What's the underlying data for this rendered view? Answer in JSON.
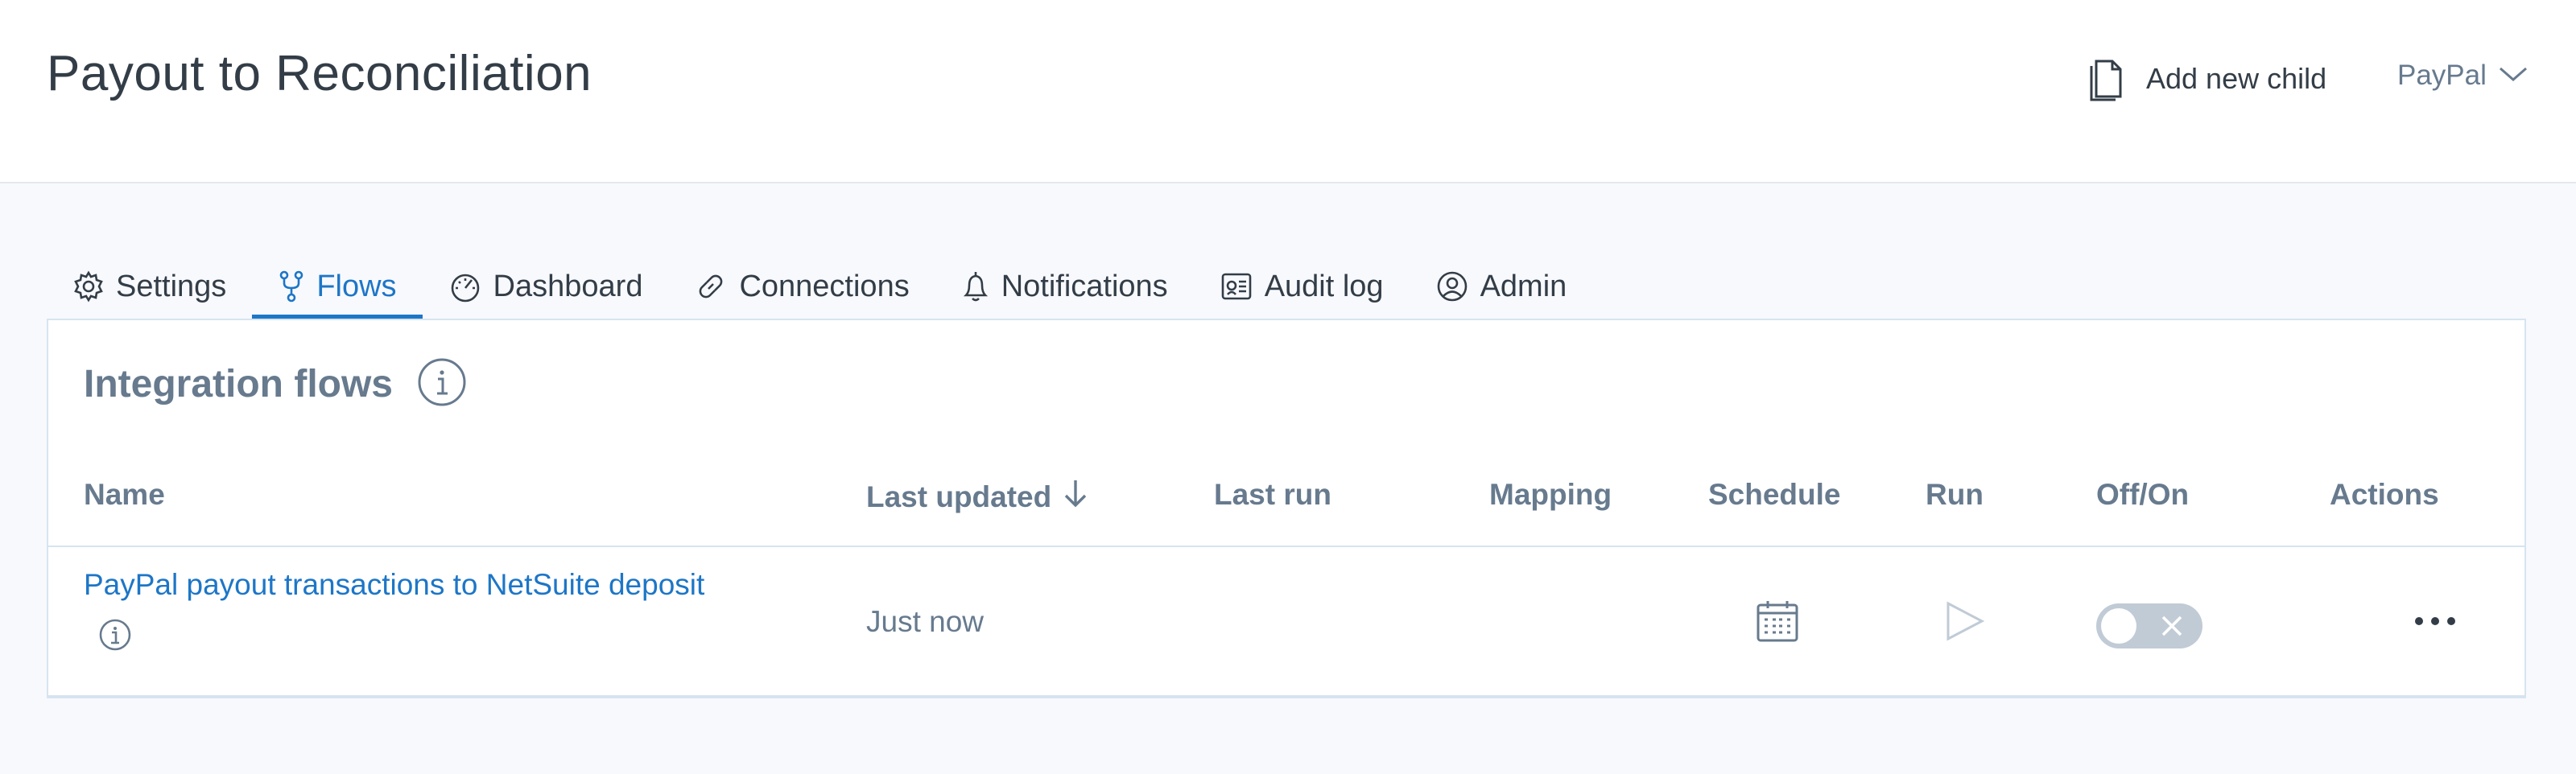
{
  "header": {
    "title": "Payout to Reconciliation",
    "add_child_label": "Add new child",
    "account_label": "PayPal"
  },
  "tabs": [
    {
      "label": "Settings",
      "icon": "gear-icon"
    },
    {
      "label": "Flows",
      "icon": "flows-icon",
      "active": true
    },
    {
      "label": "Dashboard",
      "icon": "dashboard-icon"
    },
    {
      "label": "Connections",
      "icon": "link-icon"
    },
    {
      "label": "Notifications",
      "icon": "bell-icon"
    },
    {
      "label": "Audit log",
      "icon": "audit-log-icon"
    },
    {
      "label": "Admin",
      "icon": "user-icon"
    }
  ],
  "panel": {
    "title": "Integration flows",
    "columns": {
      "name": "Name",
      "last_updated": "Last updated",
      "last_run": "Last run",
      "mapping": "Mapping",
      "schedule": "Schedule",
      "run": "Run",
      "off_on": "Off/On",
      "actions": "Actions"
    },
    "rows": [
      {
        "name": "PayPal payout transactions to NetSuite deposit",
        "last_updated": "Just now",
        "last_run": "",
        "enabled": false
      }
    ]
  },
  "colors": {
    "accent": "#1d76c7",
    "muted_text": "#677a8e",
    "toggle_off": "#c0cbd6"
  }
}
